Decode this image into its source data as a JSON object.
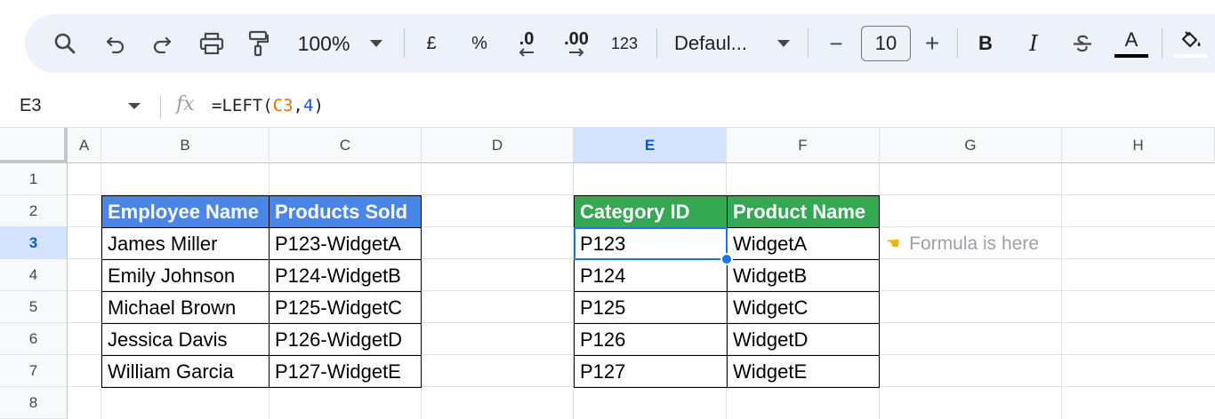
{
  "toolbar": {
    "zoom": "100%",
    "currency": "£",
    "percent": "%",
    "decrease_decimal": ".0",
    "increase_decimal": ".00",
    "number_format": "123",
    "font_name": "Defaul...",
    "font_size": "10",
    "minus": "−",
    "plus": "+",
    "bold": "B",
    "italic": "I",
    "text_color_letter": "A",
    "text_color": "#000000"
  },
  "formula_bar": {
    "cell_ref": "E3",
    "fx": "fx",
    "formula_prefix": "=LEFT(",
    "formula_ref": "C3",
    "formula_comma": ",",
    "formula_num": "4",
    "formula_suffix": ")"
  },
  "columns": [
    "A",
    "B",
    "C",
    "D",
    "E",
    "F",
    "G",
    "H"
  ],
  "rows": [
    "1",
    "2",
    "3",
    "4",
    "5",
    "6",
    "7",
    "8"
  ],
  "table1": {
    "headers": [
      "Employee Name",
      "Products Sold"
    ],
    "rows": [
      [
        "James Miller",
        "P123-WidgetA"
      ],
      [
        "Emily Johnson",
        "P124-WidgetB"
      ],
      [
        "Michael Brown",
        "P125-WidgetC"
      ],
      [
        "Jessica Davis",
        "P126-WidgetD"
      ],
      [
        "William Garcia",
        "P127-WidgetE"
      ]
    ],
    "header_color": "#4a86e8"
  },
  "table2": {
    "headers": [
      "Category ID",
      "Product Name"
    ],
    "rows": [
      [
        "P123",
        "WidgetA"
      ],
      [
        "P124",
        "WidgetB"
      ],
      [
        "P125",
        "WidgetC"
      ],
      [
        "P126",
        "WidgetD"
      ],
      [
        "P127",
        "WidgetE"
      ]
    ],
    "header_color": "#34a853"
  },
  "note": {
    "icon": "pointing-hand-icon",
    "text": "Formula is here"
  },
  "selection": {
    "cell": "E3",
    "color": "#1a73e8"
  }
}
